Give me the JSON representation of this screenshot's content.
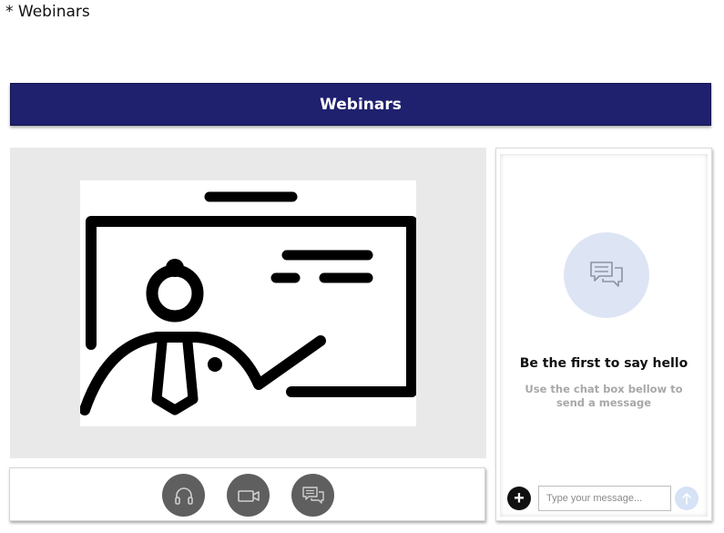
{
  "page": {
    "heading": "* Webinars"
  },
  "header": {
    "title": "Webinars"
  },
  "controls": {
    "buttons": [
      {
        "icon": "headphones-icon",
        "name": "audio"
      },
      {
        "icon": "video-camera-icon",
        "name": "video"
      },
      {
        "icon": "chat-icon",
        "name": "chat"
      }
    ],
    "button_color": "#5f5f5f"
  },
  "chat": {
    "empty_title": "Be the first to say hello",
    "empty_subtitle": "Use the chat box bellow to send a message",
    "input_placeholder": "Type your message...",
    "add_symbol": "+",
    "accent_color": "#dde4f3"
  },
  "colors": {
    "header_bg": "#1f216e",
    "video_panel_bg": "#e9e9e9"
  }
}
